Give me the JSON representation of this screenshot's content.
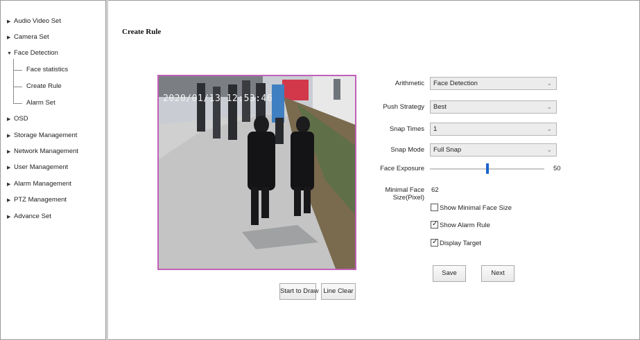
{
  "sidebar": {
    "items": [
      {
        "label": "Audio Video Set"
      },
      {
        "label": "Camera Set"
      },
      {
        "label": "Face Detection"
      },
      {
        "label": "OSD"
      },
      {
        "label": "Storage Management"
      },
      {
        "label": "Network Management"
      },
      {
        "label": "User Management"
      },
      {
        "label": "Alarm Management"
      },
      {
        "label": "PTZ Management"
      },
      {
        "label": "Advance Set"
      }
    ],
    "subitems": [
      {
        "label": "Face statistics"
      },
      {
        "label": "Create Rule"
      },
      {
        "label": "Alarm Set"
      }
    ]
  },
  "page": {
    "title": "Create Rule"
  },
  "video": {
    "timestamp": "2020/01/13 12:53:46"
  },
  "buttons": {
    "start_to_draw": "Start to Draw",
    "line_clear": "Line Clear",
    "save": "Save",
    "next": "Next"
  },
  "form": {
    "arithmetic": {
      "label": "Arithmetic",
      "value": "Face Detection"
    },
    "push_strategy": {
      "label": "Push Strategy",
      "value": "Best"
    },
    "snap_times": {
      "label": "Snap Times",
      "value": "1"
    },
    "snap_mode": {
      "label": "Snap Mode",
      "value": "Full Snap"
    },
    "face_exposure": {
      "label": "Face Exposure",
      "value": "50",
      "level_fraction": 0.5
    },
    "minimal_face": {
      "label_line1": "Minimal Face",
      "label_line2": "Size(Pixel)",
      "value": "62"
    },
    "checkboxes": [
      {
        "label": "Show Minimal Face Size",
        "checked": false
      },
      {
        "label": "Show Alarm Rule",
        "checked": true
      },
      {
        "label": "Display Target",
        "checked": true
      }
    ]
  },
  "colors": {
    "video_border": "#c060b8",
    "slider_thumb": "#1a63c9"
  }
}
